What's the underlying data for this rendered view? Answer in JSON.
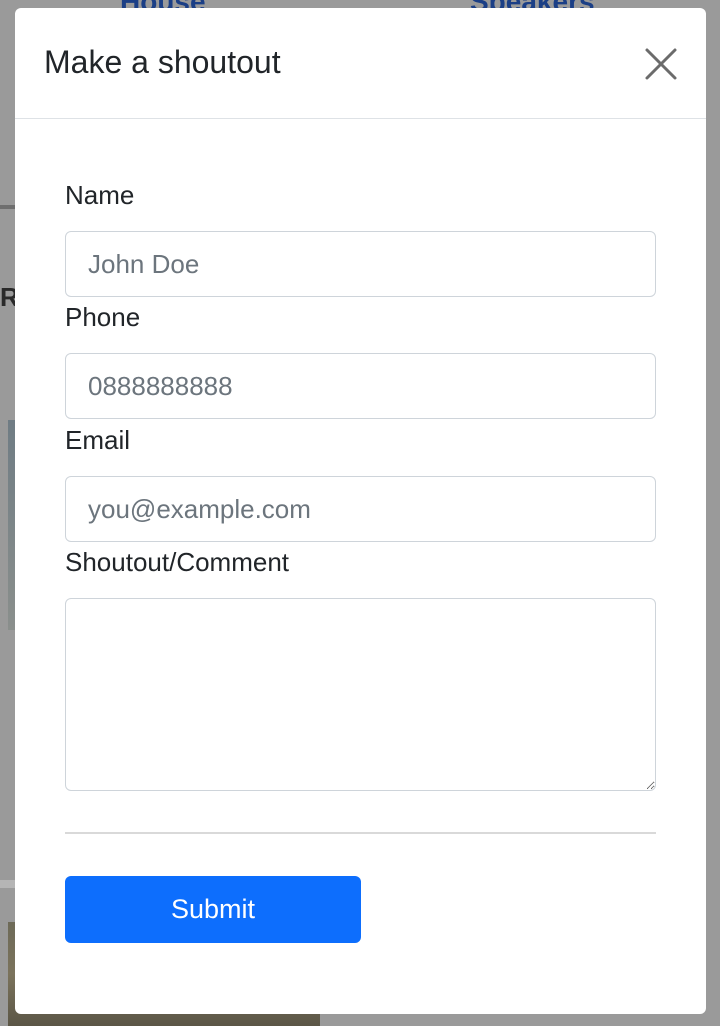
{
  "background": {
    "nav_left": "House",
    "nav_right": "Speakers",
    "side_letter": "R"
  },
  "modal": {
    "title": "Make a shoutout",
    "close_icon": "close-icon"
  },
  "form": {
    "name": {
      "label": "Name",
      "placeholder": "John Doe",
      "value": ""
    },
    "phone": {
      "label": "Phone",
      "placeholder": "0888888888",
      "value": ""
    },
    "email": {
      "label": "Email",
      "placeholder": "you@example.com",
      "value": ""
    },
    "comment": {
      "label": "Shoutout/Comment",
      "value": ""
    },
    "submit_label": "Submit"
  },
  "colors": {
    "primary": "#0d6efd",
    "text": "#212529",
    "placeholder": "#6c757d",
    "border": "#ced4da"
  }
}
